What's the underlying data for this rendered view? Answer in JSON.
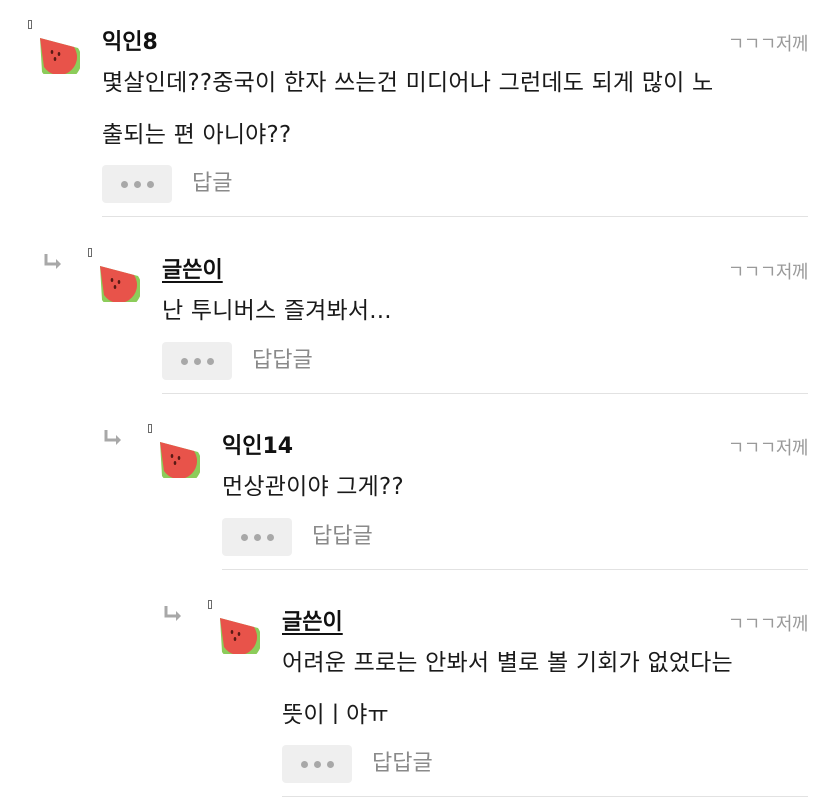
{
  "comments": [
    {
      "author": "익인8",
      "time": "ㄱㄱㄱ저께",
      "lines": [
        "몇살인데??중국이 한자 쓰는건 미디어나 그런데도 되게 많이 노",
        "출되는 편 아니야??"
      ],
      "reply_label": "답글",
      "avatar_icon": "watermelon-icon",
      "is_op": false
    },
    {
      "author": "글쓴이",
      "time": "ㄱㄱㄱ저께",
      "lines": [
        "난 투니버스 즐겨봐서..."
      ],
      "reply_label": "답답글",
      "avatar_icon": "watermelon-icon",
      "is_op": true
    },
    {
      "author": "익인14",
      "time": "ㄱㄱㄱ저께",
      "lines": [
        "먼상관이야 그게??"
      ],
      "reply_label": "답답글",
      "avatar_icon": "watermelon-icon",
      "is_op": false
    },
    {
      "author": "글쓴이",
      "time": "ㄱㄱㄱ저께",
      "lines": [
        "어려운 프로는 안봐서 별로 볼 기회가 없었다는",
        "뜻이ㅣ야ㅠ"
      ],
      "reply_label": "답답글",
      "avatar_icon": "watermelon-icon",
      "is_op": true
    }
  ],
  "colors": {
    "watermelon_flesh": "#e8534a",
    "watermelon_rind": "#8ccc5a",
    "seed": "#5a1a14"
  }
}
